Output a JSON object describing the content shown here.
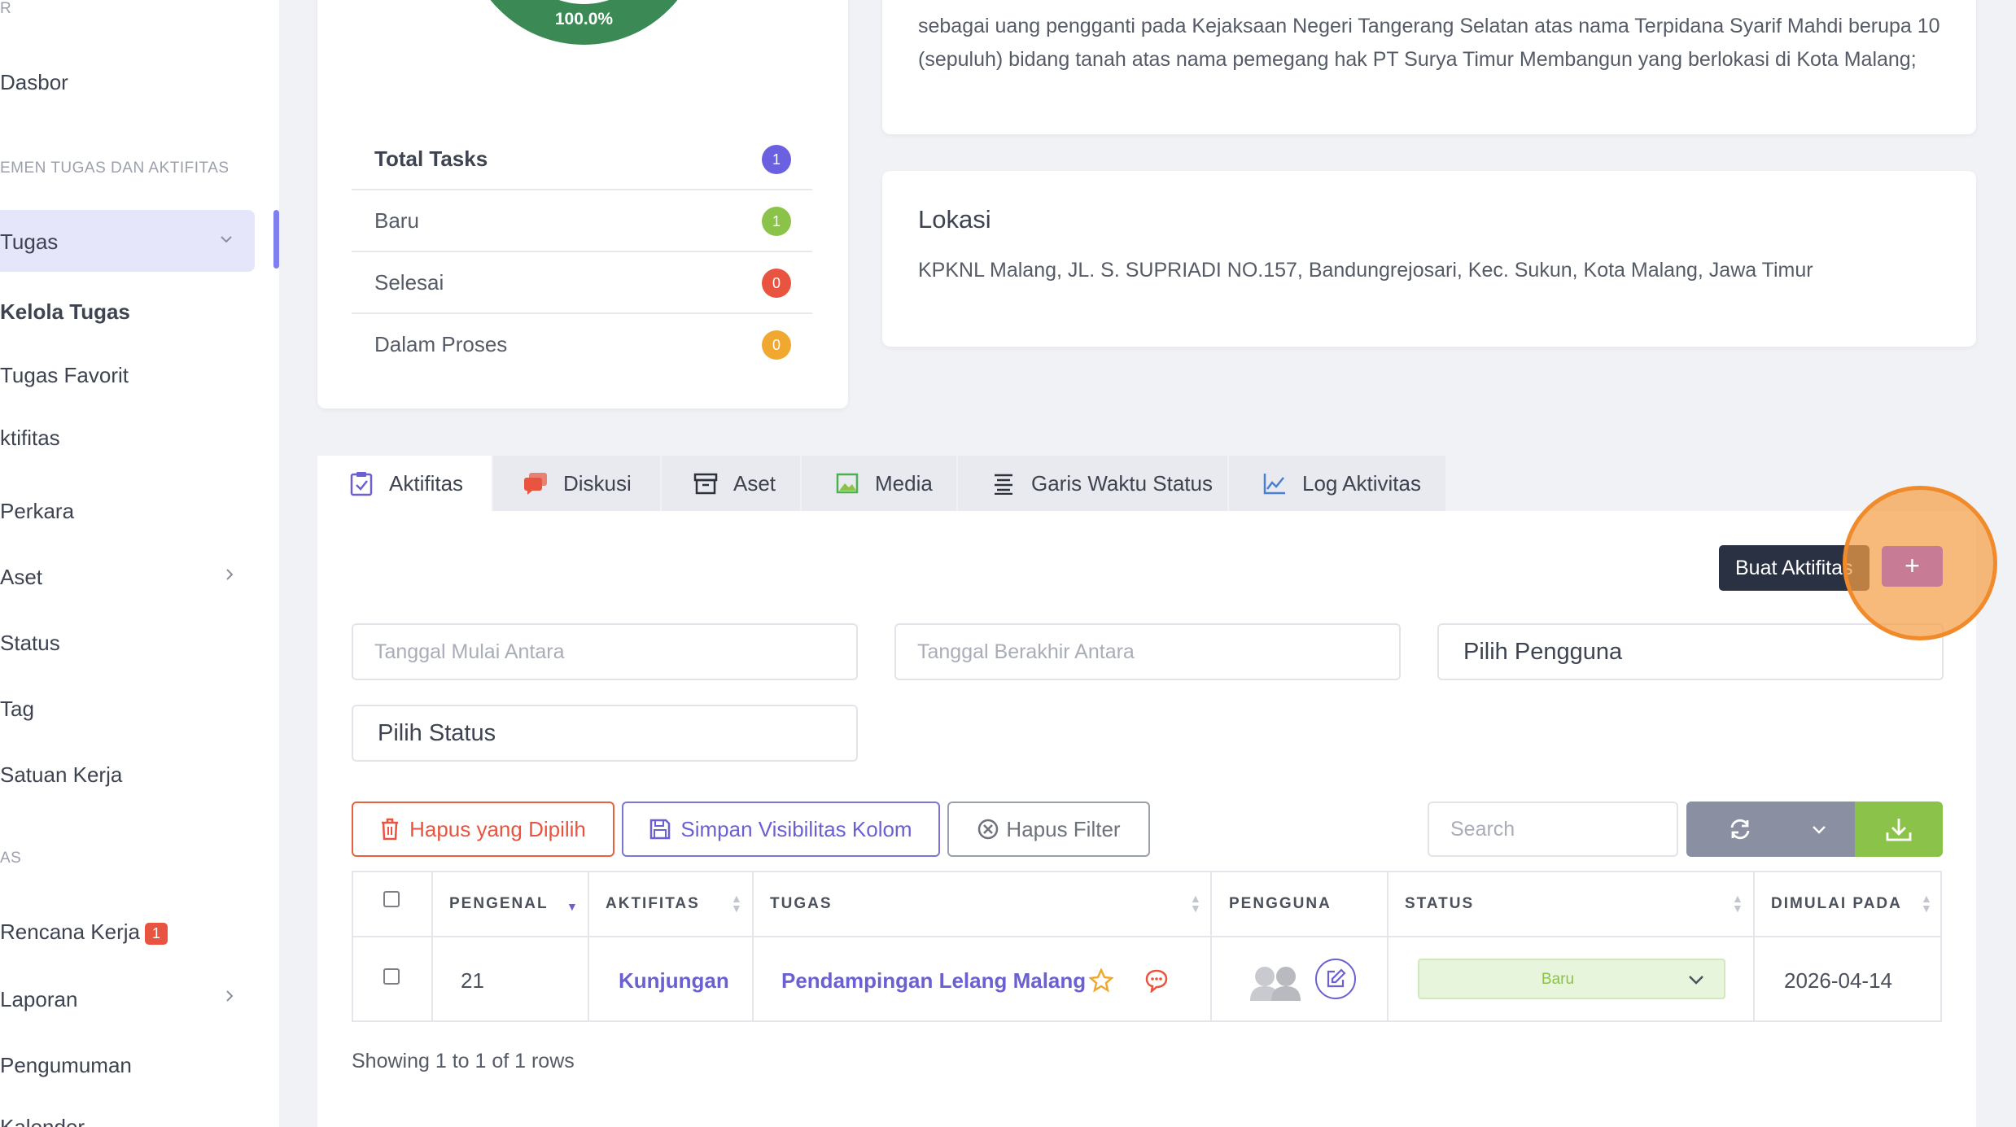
{
  "sidebar": {
    "partial_top": "R",
    "dashboard": "Dasbor",
    "section_tasks": "EMEN TUGAS DAN AKTIFITAS",
    "tasks": "Tugas",
    "manage_tasks": "Kelola Tugas",
    "favorite_tasks": "Tugas Favorit",
    "activities": "ktifitas",
    "cases": "Perkara",
    "assets": "Aset",
    "status": "Status",
    "tag": "Tag",
    "work_unit": "Satuan Kerja",
    "section_two": "AS",
    "work_plan": "Rencana Kerja",
    "work_plan_badge": "1",
    "reports": "Laporan",
    "announcements": "Pengumuman",
    "partial_bottom": "Kalender"
  },
  "summary": {
    "donut_label": "100.0%",
    "rows": [
      {
        "label": "Total Tasks",
        "count": "1",
        "color": "#6a60e0"
      },
      {
        "label": "Baru",
        "count": "1",
        "color": "#8bc34a"
      },
      {
        "label": "Selesai",
        "count": "0",
        "color": "#e8543f"
      },
      {
        "label": "Dalam Proses",
        "count": "0",
        "color": "#f0a830"
      }
    ]
  },
  "description": {
    "line1": "sebagai uang pengganti pada Kejaksaan Negeri Tangerang Selatan atas nama Terpidana Syarif Mahdi berupa 10",
    "line2": "(sepuluh) bidang tanah atas nama pemegang hak PT Surya Timur Membangun yang berlokasi di Kota Malang;"
  },
  "location": {
    "title": "Lokasi",
    "address": "KPKNL Malang, JL. S. SUPRIADI NO.157, Bandungrejosari, Kec. Sukun, Kota Malang, Jawa Timur"
  },
  "tabs": [
    {
      "label": "Aktifitas",
      "icon": "clipboard-check-icon"
    },
    {
      "label": "Diskusi",
      "icon": "chat-bubbles-icon"
    },
    {
      "label": "Aset",
      "icon": "archive-box-icon"
    },
    {
      "label": "Media",
      "icon": "image-icon"
    },
    {
      "label": "Garis Waktu Status",
      "icon": "list-lines-icon"
    },
    {
      "label": "Log Aktivitas",
      "icon": "line-chart-icon"
    }
  ],
  "tooltip": "Buat Aktifitas",
  "add_button": "+",
  "filters": {
    "start_date_placeholder": "Tanggal Mulai Antara",
    "end_date_placeholder": "Tanggal Berakhir Antara",
    "user_select": "Pilih Pengguna",
    "status_select": "Pilih Status"
  },
  "toolbar": {
    "delete_selected": "Hapus yang Dipilih",
    "save_visibility": "Simpan Visibilitas Kolom",
    "clear_filter": "Hapus Filter",
    "search_placeholder": "Search"
  },
  "table": {
    "headers": [
      "PENGENAL",
      "AKTIFITAS",
      "TUGAS",
      "PENGGUNA",
      "STATUS",
      "DIMULAI PADA"
    ],
    "row": {
      "id": "21",
      "activity": "Kunjungan",
      "task": "Pendampingan Lelang Malang",
      "status": "Baru",
      "started": "2026-04-14"
    },
    "footer": "Showing 1 to 1 of 1 rows"
  }
}
